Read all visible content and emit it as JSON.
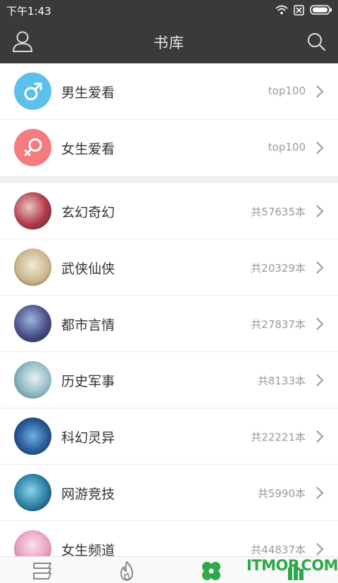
{
  "status_bar": {
    "time": "下午1:43"
  },
  "app_bar": {
    "title": "书库",
    "left_icon": "user-icon",
    "right_icon": "search-icon"
  },
  "gender_rows": [
    {
      "label": "男生爱看",
      "meta": "top100",
      "icon": "male-symbol-icon",
      "color": "#5bc0ea"
    },
    {
      "label": "女生爱看",
      "meta": "top100",
      "icon": "female-symbol-icon",
      "color": "#f57b7e"
    }
  ],
  "category_rows": [
    {
      "label": "玄幻奇幻",
      "meta": "共57635本",
      "icon": "cover-thumbnail"
    },
    {
      "label": "武侠仙侠",
      "meta": "共20329本",
      "icon": "cover-thumbnail"
    },
    {
      "label": "都市言情",
      "meta": "共27837本",
      "icon": "cover-thumbnail"
    },
    {
      "label": "历史军事",
      "meta": "共8133本",
      "icon": "cover-thumbnail"
    },
    {
      "label": "科幻灵异",
      "meta": "共22221本",
      "icon": "cover-thumbnail"
    },
    {
      "label": "网游竞技",
      "meta": "共5990本",
      "icon": "cover-thumbnail"
    },
    {
      "label": "女生频道",
      "meta": "共44837本",
      "icon": "cover-thumbnail"
    }
  ],
  "bottom_tabs": [
    {
      "icon": "bookshelf-icon",
      "active": false
    },
    {
      "icon": "flame-icon",
      "active": false
    },
    {
      "icon": "library-icon",
      "active": true
    },
    {
      "icon": "ranking-icon",
      "active": false
    }
  ],
  "watermark": "ITMOP.COM",
  "colors": {
    "bar": "#3a3a3a",
    "accent_green": "#2ea84a"
  }
}
